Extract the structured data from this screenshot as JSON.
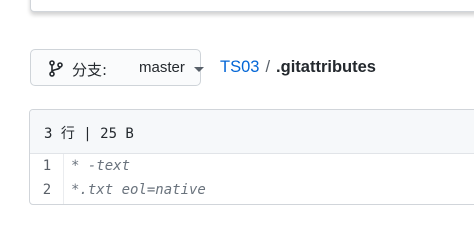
{
  "branch_selector": {
    "prefix": "分支:",
    "branch": "master",
    "icon": "git-branch-icon"
  },
  "breadcrumb": {
    "repo": "TS03",
    "separator": "/",
    "file": ".gitattributes"
  },
  "file": {
    "info": "3 行 | 25 B",
    "lines": [
      {
        "num": "1",
        "code": "* -text"
      },
      {
        "num": "2",
        "code": "*.txt eol=native"
      }
    ]
  },
  "colors": {
    "link": "#0366d6",
    "text": "#24292e",
    "comment": "#6a737d",
    "border": "#d1d5da"
  }
}
